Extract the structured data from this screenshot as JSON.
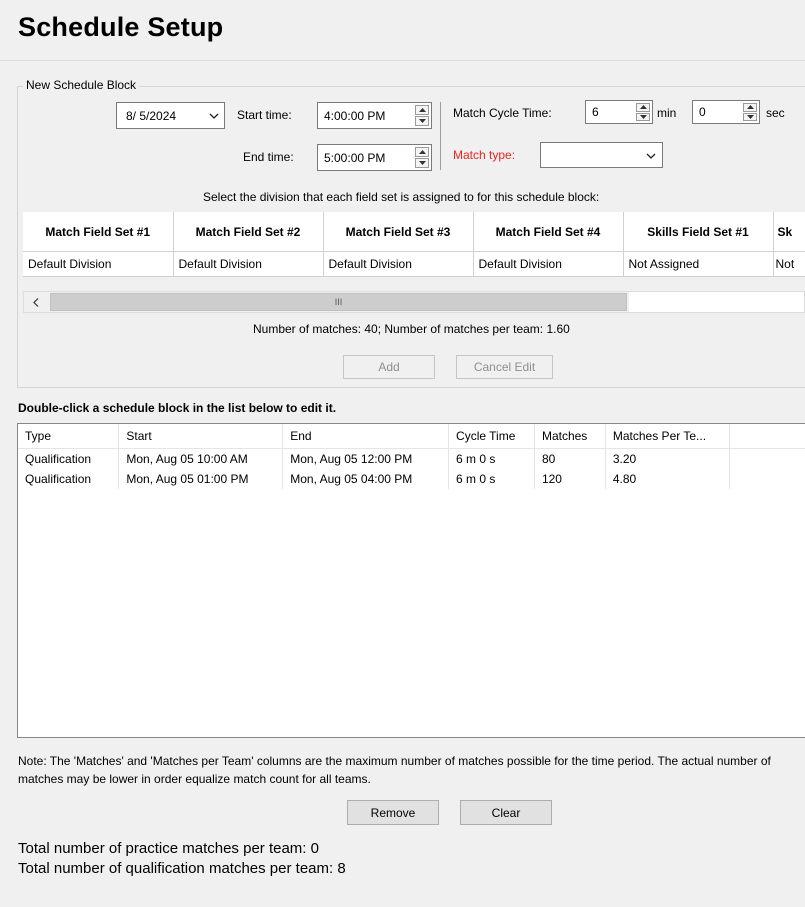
{
  "page": {
    "title": "Schedule Setup"
  },
  "new_block": {
    "group_label": "New Schedule Block",
    "date": "8/  5/2024",
    "start_time_label": "Start time:",
    "start_time": "4:00:00 PM",
    "end_time_label": "End time:",
    "end_time": "5:00:00 PM",
    "cycle_label": "Match Cycle Time:",
    "cycle_min": "6",
    "min_label": "min",
    "cycle_sec": "0",
    "sec_label": "sec",
    "match_type_label": "Match type:",
    "match_type_value": "",
    "match_type_label_color": "#e8251d",
    "division_prompt": "Select the division that each field set is assigned to for this schedule block:"
  },
  "field_sets": {
    "headers": [
      "Match Field Set #1",
      "Match Field Set #2",
      "Match Field Set #3",
      "Match Field Set #4",
      "Skills Field Set #1",
      "Sk"
    ],
    "values": [
      "Default Division",
      "Default Division",
      "Default Division",
      "Default Division",
      "Not Assigned",
      "Not"
    ]
  },
  "scrollbar": {
    "thumb_glyph": "III"
  },
  "summary": {
    "matches_text": "Number of matches: 40; Number of matches per team: 1.60"
  },
  "buttons": {
    "add": "Add",
    "cancel_edit": "Cancel Edit",
    "remove": "Remove",
    "clear": "Clear"
  },
  "list_hint": "Double-click a schedule block in the list below to edit it.",
  "blocks": {
    "columns": [
      "Type",
      "Start",
      "End",
      "Cycle Time",
      "Matches",
      "Matches Per Te..."
    ],
    "rows": [
      [
        "Qualification",
        "Mon, Aug 05 10:00 AM",
        "Mon, Aug 05 12:00 PM",
        "6 m 0 s",
        "80",
        "3.20"
      ],
      [
        "Qualification",
        "Mon, Aug 05 01:00 PM",
        "Mon, Aug 05 04:00 PM",
        "6 m 0 s",
        "120",
        "4.80"
      ]
    ]
  },
  "note": "Note: The 'Matches' and 'Matches per Team' columns are the maximum number of matches possible for the time period.  The actual number of matches may be lower in order equalize match count for all teams.",
  "totals": {
    "practice": "Total number of practice matches per team: 0",
    "qualification": "Total number of qualification matches per team: 8"
  }
}
